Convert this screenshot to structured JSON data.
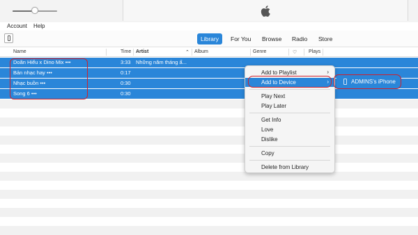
{
  "titlebar": {
    "volume_level": 0.5
  },
  "menubar": {
    "items": [
      "Account",
      "Help"
    ]
  },
  "nav": {
    "tabs": [
      "Library",
      "For You",
      "Browse",
      "Radio",
      "Store"
    ],
    "active_tab": "Library"
  },
  "columns": [
    "Name",
    "Time",
    "Artist",
    "Album",
    "Genre",
    "Plays"
  ],
  "songs": [
    {
      "name": "Doãn Hiếu x Dino Mix •••",
      "time": "3:33",
      "artist": "Những năm tháng ấ..."
    },
    {
      "name": "Bản nhạc hay •••",
      "time": "0:17",
      "artist": ""
    },
    {
      "name": "Nhạc buồn •••",
      "time": "0:30",
      "artist": ""
    },
    {
      "name": "Song 6 •••",
      "time": "0:30",
      "artist": ""
    }
  ],
  "context_menu": {
    "items": [
      "Add to Playlist",
      "Add to Device",
      "Play Next",
      "Play Later",
      "Get Info",
      "Love",
      "Dislike",
      "Copy",
      "Delete from Library"
    ]
  },
  "submenu": {
    "device": "ADMINS's iPhone"
  },
  "colors": {
    "accent": "#2a86d9",
    "annotation": "#d0202a"
  }
}
